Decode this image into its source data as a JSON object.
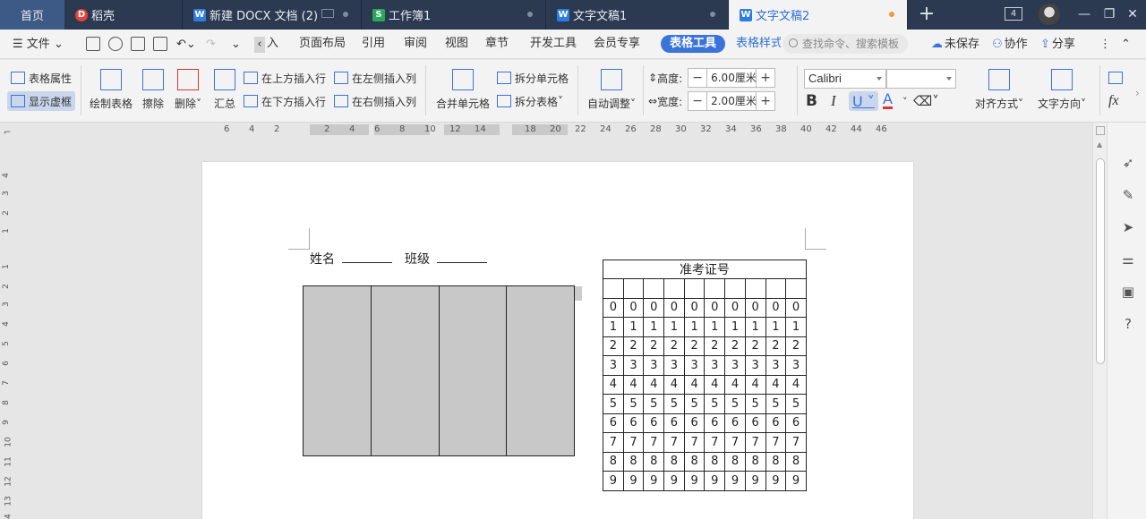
{
  "tabs": {
    "home": "首页",
    "daoke": "稻壳",
    "doc1": "新建 DOCX 文档 (2)",
    "sheet": "工作簿1",
    "doc2": "文字文稿1",
    "doc3": "文字文稿2",
    "window_count": "4"
  },
  "menubar": {
    "file": "文件",
    "tabs": [
      "入",
      "页面布局",
      "引用",
      "审阅",
      "视图",
      "章节",
      "开发工具",
      "会员专享",
      "表格工具",
      "表格样式"
    ],
    "search_placeholder": "查找命令、搜索模板",
    "unsaved": "未保存",
    "collab": "协作",
    "share": "分享"
  },
  "ribbon": {
    "table_props": "表格属性",
    "show_gridlines": "显示虚框",
    "draw_table": "绘制表格",
    "eraser": "擦除",
    "delete": "删除",
    "summary": "汇总",
    "insert_row_above": "在上方插入行",
    "insert_row_below": "在下方插入行",
    "insert_col_left": "在左侧插入列",
    "insert_col_right": "在右侧插入列",
    "merge_cells": "合并单元格",
    "split_cells": "拆分单元格",
    "split_table": "拆分表格",
    "auto_fit": "自动调整",
    "height_label": "高度:",
    "height_value": "6.00厘米",
    "width_label": "宽度:",
    "width_value": "2.00厘米",
    "font_name": "Calibri",
    "font_size": "",
    "align": "对齐方式",
    "text_dir": "文字方向",
    "fx": "fx"
  },
  "ruler": {
    "numbers": [
      "6",
      "4",
      "2",
      "2",
      "4",
      "6",
      "8",
      "10",
      "12",
      "14",
      "18",
      "20",
      "22",
      "24",
      "26",
      "28",
      "30",
      "32",
      "34",
      "36",
      "38",
      "40",
      "42",
      "44",
      "46"
    ],
    "vnumbers": [
      "4",
      "3",
      "2",
      "1",
      "1",
      "2",
      "3",
      "4",
      "5",
      "6",
      "7",
      "8",
      "9",
      "10",
      "11",
      "12",
      "13",
      "14"
    ]
  },
  "document": {
    "name_label": "姓名",
    "class_label": "班级",
    "exam_title": "准考证号",
    "digits": [
      "0",
      "1",
      "2",
      "3",
      "4",
      "5",
      "6",
      "7",
      "8",
      "9"
    ],
    "columns": 10
  }
}
